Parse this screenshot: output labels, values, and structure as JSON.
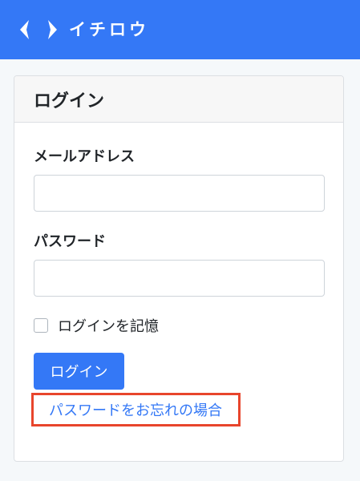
{
  "header": {
    "brand_name": "イチロウ",
    "logo_icon": "chevrons-logo-icon",
    "brand_color": "#3478f6"
  },
  "login_card": {
    "title": "ログイン",
    "email": {
      "label": "メールアドレス",
      "value": "",
      "placeholder": ""
    },
    "password": {
      "label": "パスワード",
      "value": "",
      "placeholder": ""
    },
    "remember_me": {
      "label": "ログインを記憶",
      "checked": false
    },
    "submit_label": "ログイン",
    "forgot_password_link": "パスワードをお忘れの場合",
    "highlight_color": "#e8452c"
  }
}
